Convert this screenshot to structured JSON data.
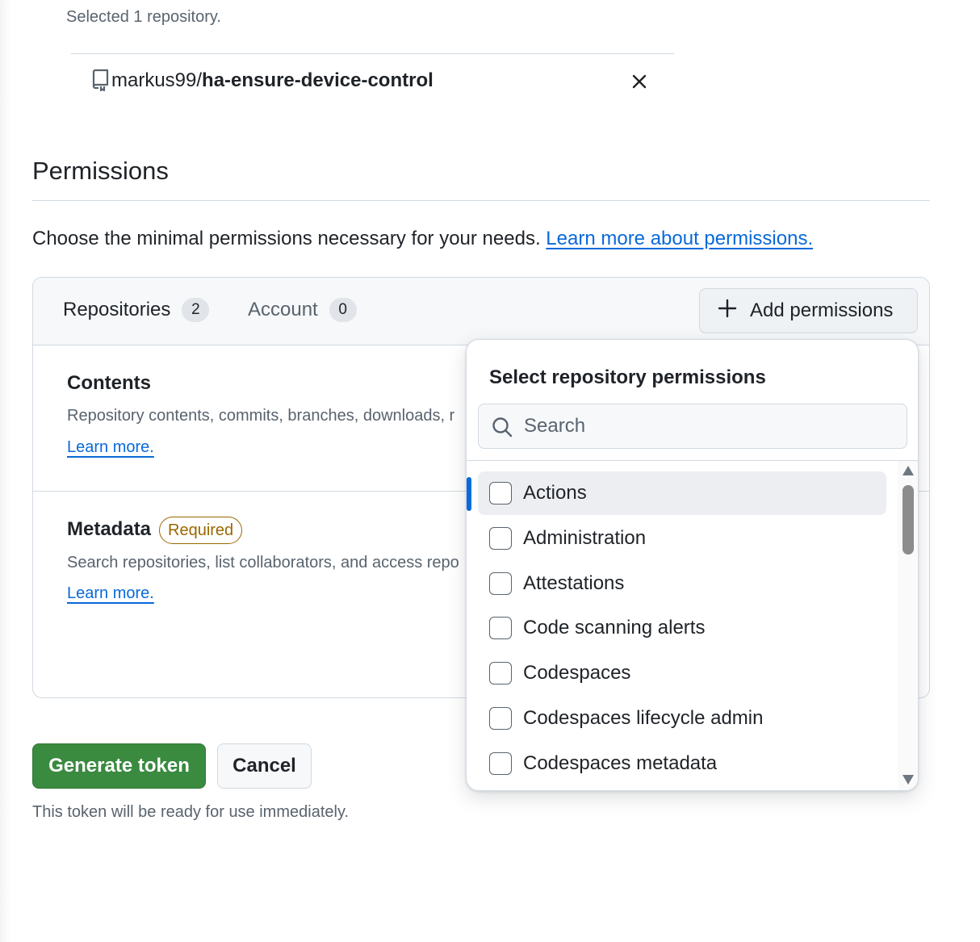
{
  "selected_repos": {
    "count_text": "Selected 1 repository.",
    "repo_owner": "markus99/",
    "repo_short_name": "ha-ensure-device-control"
  },
  "permissions": {
    "heading": "Permissions",
    "description": "Choose the minimal permissions necessary for your needs.",
    "learn_more_link": "Learn more about permissions.",
    "tabs": [
      {
        "label": "Repositories",
        "count": "2"
      },
      {
        "label": "Account",
        "count": "0"
      }
    ],
    "add_button_label": "Add permissions",
    "sections": [
      {
        "title": "Contents",
        "description": "Repository contents, commits, branches, downloads, r",
        "link": "Learn more."
      },
      {
        "title": "Metadata",
        "badge": "Required",
        "description": "Search repositories, list collaborators, and access repo",
        "link": "Learn more."
      }
    ]
  },
  "dropdown": {
    "title": "Select repository permissions",
    "search_placeholder": "Search",
    "items": [
      {
        "label": "Actions",
        "checked": false,
        "active": true
      },
      {
        "label": "Administration",
        "checked": false
      },
      {
        "label": "Attestations",
        "checked": false
      },
      {
        "label": "Code scanning alerts",
        "checked": false
      },
      {
        "label": "Codespaces",
        "checked": false
      },
      {
        "label": "Codespaces lifecycle admin",
        "checked": false
      },
      {
        "label": "Codespaces metadata",
        "checked": false
      }
    ]
  },
  "actions": {
    "generate_label": "Generate token",
    "cancel_label": "Cancel",
    "note": "This token will be ready for use immediately."
  },
  "colors": {
    "link": "#0969da",
    "primary_button": "#3a8a40",
    "required_badge": "#9a6700",
    "active_indicator": "#0969da"
  }
}
